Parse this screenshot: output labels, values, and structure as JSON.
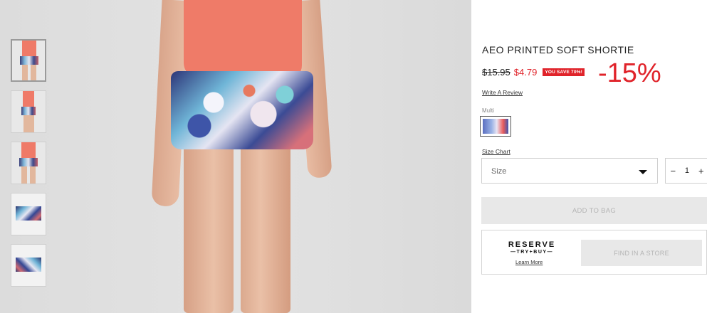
{
  "product": {
    "title": "AEO PRINTED SOFT SHORTIE",
    "old_price": "$15.95",
    "new_price": "$4.79",
    "save_badge": "YOU SAVE 70%!",
    "discount_overlay": "-15%",
    "write_review": "Write A Review",
    "color_label": "Multi",
    "size_chart": "Size Chart",
    "size_placeholder": "Size",
    "quantity": "1",
    "qty_minus": "−",
    "qty_plus": "+",
    "add_to_bag": "ADD TO BAG",
    "reserve_title": "RESERVE",
    "reserve_subtitle": "—TRY+BUY—",
    "learn_more": "Learn More",
    "find_in_store": "FIND IN A STORE"
  },
  "gallery": {
    "thumbnails": [
      "model-front",
      "model-side",
      "model-front-2",
      "flat-front",
      "flat-back"
    ],
    "selected_index": 0
  },
  "colors": {
    "sale_red": "#e0232a",
    "disabled_button": "#e8e8e8",
    "disabled_text": "#b4b4b4"
  }
}
